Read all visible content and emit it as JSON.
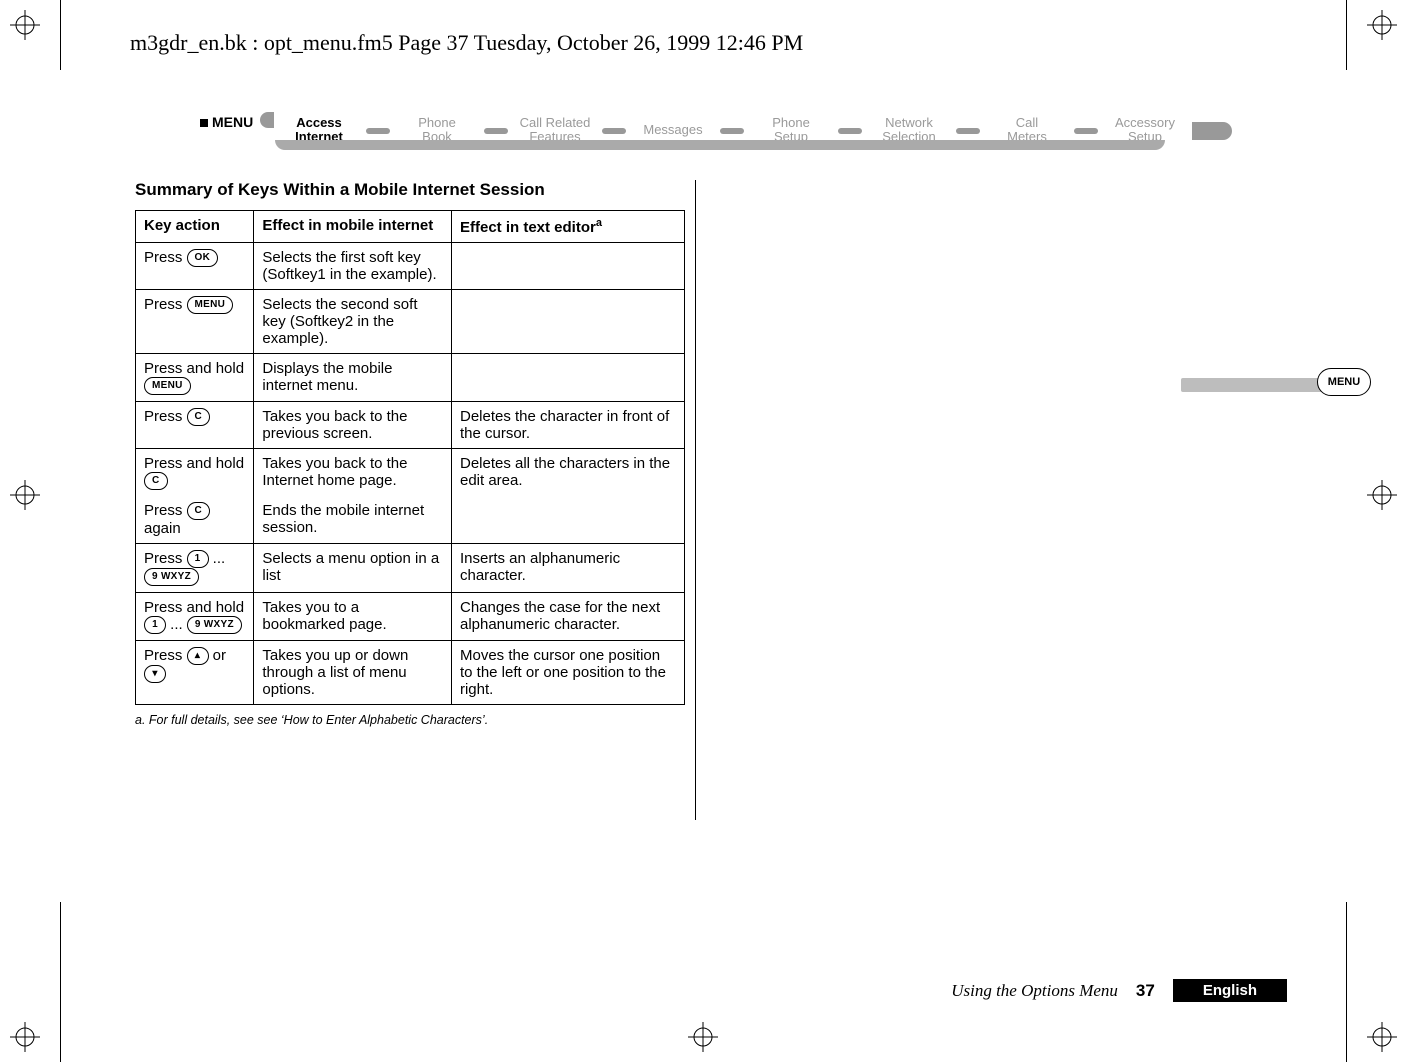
{
  "header_line": "m3gdr_en.bk : opt_menu.fm5  Page 37  Tuesday, October 26, 1999  12:46 PM",
  "ribbon": {
    "menu_tag": "MENU",
    "items": [
      {
        "top": "Access",
        "bot": "Internet",
        "active": true
      },
      {
        "top": "Phone",
        "bot": "Book",
        "active": false
      },
      {
        "top": "Call Related",
        "bot": "Features",
        "active": false
      },
      {
        "top": "Messages",
        "bot": "",
        "active": false
      },
      {
        "top": "Phone",
        "bot": "Setup",
        "active": false
      },
      {
        "top": "Network",
        "bot": "Selection",
        "active": false
      },
      {
        "top": "Call",
        "bot": "Meters",
        "active": false
      },
      {
        "top": "Accessory",
        "bot": "Setup",
        "active": false
      }
    ]
  },
  "section_heading": "Summary of Keys Within a Mobile Internet Session",
  "table": {
    "headers": [
      "Key action",
      "Effect in mobile internet",
      "Effect in text editor"
    ],
    "header_sup": "a",
    "rows": [
      {
        "action_prefix": "Press ",
        "keys": [
          "OK"
        ],
        "mobile": "Selects the first soft key (Softkey1 in the example).",
        "editor": ""
      },
      {
        "action_prefix": "Press ",
        "keys": [
          "MENU"
        ],
        "mobile": "Selects the second soft key (Softkey2 in the example).",
        "editor": ""
      },
      {
        "action_prefix": "Press and hold ",
        "keys": [
          "MENU"
        ],
        "mobile": "Displays the mobile internet menu.",
        "editor": ""
      },
      {
        "action_prefix": "Press ",
        "keys": [
          "C"
        ],
        "mobile": "Takes you back to the previous screen.",
        "editor": "Deletes the character in front of the cursor."
      },
      {
        "action_prefix": "Press and hold ",
        "keys": [
          "C"
        ],
        "mobile": "Takes you back to the Internet home page.",
        "editor": "Deletes all the characters in the edit area.",
        "extra_prefix": "Press ",
        "extra_keys": [
          "C"
        ],
        "extra_suffix": " again",
        "extra_mobile": "Ends the mobile internet session."
      },
      {
        "action_prefix": "Press ",
        "keys": [
          "1",
          "9 WXYZ"
        ],
        "joiner": " ... ",
        "mobile": "Selects a menu option in a list",
        "editor": "Inserts an alphanumeric character."
      },
      {
        "action_prefix": "Press and hold ",
        "keys": [
          "1",
          "9 WXYZ"
        ],
        "joiner": " ... ",
        "mobile": "Takes you to a bookmarked page.",
        "editor": "Changes the case for the next alphanumeric character."
      },
      {
        "action_prefix": "Press ",
        "keys": [
          "▴",
          "▾"
        ],
        "joiner": " or ",
        "mobile": "Takes you up or down through a list of menu options.",
        "editor": "Moves the cursor one position to the left or one position to the right."
      }
    ]
  },
  "footnote": "a.    For full details, see see ‘How to Enter Alphabetic Characters’.",
  "thumb_label": "MENU",
  "footer": {
    "section": "Using the Options Menu",
    "page": "37",
    "lang": "English"
  }
}
